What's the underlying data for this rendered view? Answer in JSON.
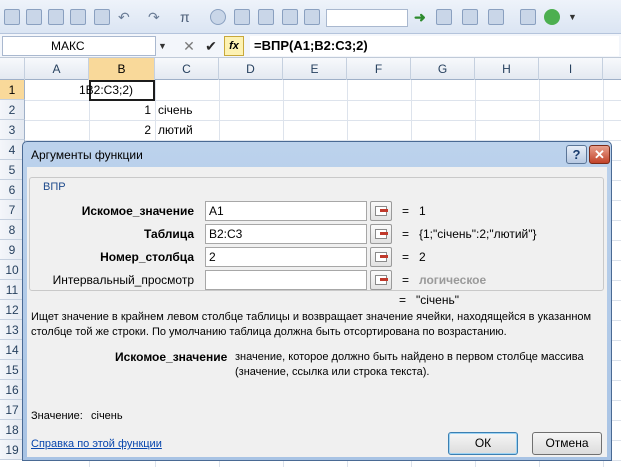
{
  "namebox": {
    "value": "МАКС"
  },
  "formula_bar": {
    "cancel_glyph": "✕",
    "enter_glyph": "✔",
    "fx_label": "fx",
    "formula": "=ВПР(A1;B2:C3;2)"
  },
  "columns": [
    "A",
    "B",
    "C",
    "D",
    "E",
    "F",
    "G",
    "H",
    "I"
  ],
  "rows": [
    "1",
    "2",
    "3",
    "4",
    "5",
    "6",
    "7",
    "8",
    "9",
    "10",
    "11",
    "12",
    "13",
    "14",
    "15",
    "16",
    "17",
    "18",
    "19"
  ],
  "cells": {
    "b1_edit": "1B2:C3;2)",
    "b2": "1",
    "c2": "січень",
    "b3": "2",
    "c3": "лютий"
  },
  "dialog": {
    "title": "Аргументы функции",
    "help_button": "?",
    "close_button": "✕",
    "function_group": "ВПР",
    "args": [
      {
        "label": "Искомое_значение",
        "input": "A1",
        "result": "1",
        "bold": true
      },
      {
        "label": "Таблица",
        "input": "B2:C3",
        "result": "{1;\"січень\":2;\"лютий\"}",
        "bold": true
      },
      {
        "label": "Номер_столбца",
        "input": "2",
        "result": "2",
        "bold": true
      },
      {
        "label": "Интервальный_просмотр",
        "input": "",
        "result": "логическое",
        "bold": false
      }
    ],
    "equals_sign": "=",
    "overall_result": "\"січень\"",
    "description": "Ищет значение в крайнем левом столбце таблицы и возвращает значение ячейки, находящейся в указанном столбце той же строки. По умолчанию таблица должна быть отсортирована по возрастанию.",
    "current_arg_name": "Искомое_значение",
    "current_arg_desc": "значение, которое должно быть найдено в первом столбце массива (значение, ссылка или строка текста).",
    "value_label": "Значение:",
    "value": "січень",
    "help_link": "Справка по этой функции",
    "ok_button": "ОК",
    "cancel_button": "Отмена"
  }
}
